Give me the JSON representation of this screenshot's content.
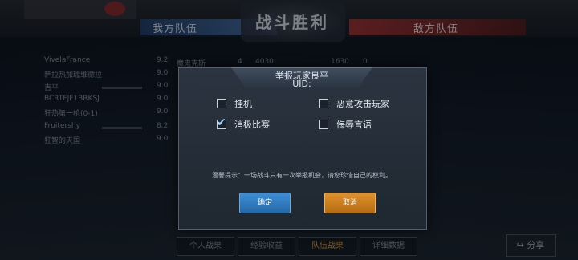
{
  "header": {
    "title": "战斗胜利",
    "left_team": "我方队伍",
    "right_team": "敌方队伍"
  },
  "scoreboard": {
    "rows": [
      {
        "name": "VivelaFrance",
        "score": "9.2"
      },
      {
        "name": "萨拉热加瑞维德拉",
        "score": "9.0"
      },
      {
        "name": "吉平",
        "score": "9.0"
      },
      {
        "name": "BCRTFJF1BRKSJ",
        "score": "9.0"
      },
      {
        "name": "狂热第一枪(0-1)",
        "score": "9.0"
      },
      {
        "name": "Fruitershy",
        "score": "8.2"
      },
      {
        "name": "狂智的天国",
        "score": "9.0"
      }
    ],
    "ship_text": "魔鬼克斯",
    "kills": "4",
    "damage": "4030",
    "enemy_damage": "1630",
    "enemy_kills": "0"
  },
  "bottom_tabs": [
    "个人战果",
    "经验收益",
    "队伍战果",
    "详细数据"
  ],
  "share_label": "分享",
  "dialog": {
    "title": "举报玩家良平",
    "uid_label": "UID:",
    "reasons": [
      {
        "label": "挂机",
        "checked": false
      },
      {
        "label": "恶意攻击玩家",
        "checked": false
      },
      {
        "label": "消极比赛",
        "checked": true
      },
      {
        "label": "侮辱言语",
        "checked": false
      }
    ],
    "note": "温馨提示：一场战斗只有一次举报机会，请您珍惜自己的权利。",
    "confirm_label": "确定",
    "cancel_label": "取消"
  },
  "colors": {
    "confirm": "#2f7fc4",
    "cancel": "#d0841f",
    "dialog_bg": "#25303b"
  }
}
